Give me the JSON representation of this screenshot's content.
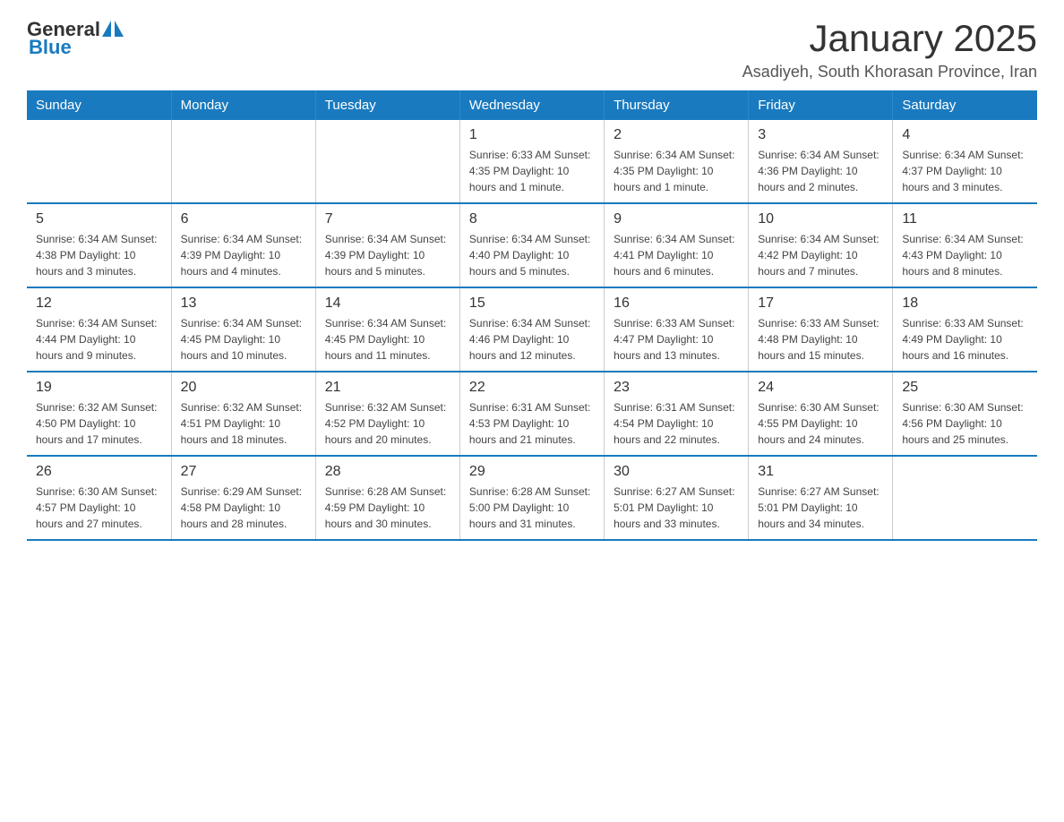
{
  "logo": {
    "general": "General",
    "blue": "Blue"
  },
  "title": "January 2025",
  "subtitle": "Asadiyeh, South Khorasan Province, Iran",
  "days_of_week": [
    "Sunday",
    "Monday",
    "Tuesday",
    "Wednesday",
    "Thursday",
    "Friday",
    "Saturday"
  ],
  "weeks": [
    [
      {
        "day": "",
        "info": ""
      },
      {
        "day": "",
        "info": ""
      },
      {
        "day": "",
        "info": ""
      },
      {
        "day": "1",
        "info": "Sunrise: 6:33 AM\nSunset: 4:35 PM\nDaylight: 10 hours and 1 minute."
      },
      {
        "day": "2",
        "info": "Sunrise: 6:34 AM\nSunset: 4:35 PM\nDaylight: 10 hours and 1 minute."
      },
      {
        "day": "3",
        "info": "Sunrise: 6:34 AM\nSunset: 4:36 PM\nDaylight: 10 hours and 2 minutes."
      },
      {
        "day": "4",
        "info": "Sunrise: 6:34 AM\nSunset: 4:37 PM\nDaylight: 10 hours and 3 minutes."
      }
    ],
    [
      {
        "day": "5",
        "info": "Sunrise: 6:34 AM\nSunset: 4:38 PM\nDaylight: 10 hours and 3 minutes."
      },
      {
        "day": "6",
        "info": "Sunrise: 6:34 AM\nSunset: 4:39 PM\nDaylight: 10 hours and 4 minutes."
      },
      {
        "day": "7",
        "info": "Sunrise: 6:34 AM\nSunset: 4:39 PM\nDaylight: 10 hours and 5 minutes."
      },
      {
        "day": "8",
        "info": "Sunrise: 6:34 AM\nSunset: 4:40 PM\nDaylight: 10 hours and 5 minutes."
      },
      {
        "day": "9",
        "info": "Sunrise: 6:34 AM\nSunset: 4:41 PM\nDaylight: 10 hours and 6 minutes."
      },
      {
        "day": "10",
        "info": "Sunrise: 6:34 AM\nSunset: 4:42 PM\nDaylight: 10 hours and 7 minutes."
      },
      {
        "day": "11",
        "info": "Sunrise: 6:34 AM\nSunset: 4:43 PM\nDaylight: 10 hours and 8 minutes."
      }
    ],
    [
      {
        "day": "12",
        "info": "Sunrise: 6:34 AM\nSunset: 4:44 PM\nDaylight: 10 hours and 9 minutes."
      },
      {
        "day": "13",
        "info": "Sunrise: 6:34 AM\nSunset: 4:45 PM\nDaylight: 10 hours and 10 minutes."
      },
      {
        "day": "14",
        "info": "Sunrise: 6:34 AM\nSunset: 4:45 PM\nDaylight: 10 hours and 11 minutes."
      },
      {
        "day": "15",
        "info": "Sunrise: 6:34 AM\nSunset: 4:46 PM\nDaylight: 10 hours and 12 minutes."
      },
      {
        "day": "16",
        "info": "Sunrise: 6:33 AM\nSunset: 4:47 PM\nDaylight: 10 hours and 13 minutes."
      },
      {
        "day": "17",
        "info": "Sunrise: 6:33 AM\nSunset: 4:48 PM\nDaylight: 10 hours and 15 minutes."
      },
      {
        "day": "18",
        "info": "Sunrise: 6:33 AM\nSunset: 4:49 PM\nDaylight: 10 hours and 16 minutes."
      }
    ],
    [
      {
        "day": "19",
        "info": "Sunrise: 6:32 AM\nSunset: 4:50 PM\nDaylight: 10 hours and 17 minutes."
      },
      {
        "day": "20",
        "info": "Sunrise: 6:32 AM\nSunset: 4:51 PM\nDaylight: 10 hours and 18 minutes."
      },
      {
        "day": "21",
        "info": "Sunrise: 6:32 AM\nSunset: 4:52 PM\nDaylight: 10 hours and 20 minutes."
      },
      {
        "day": "22",
        "info": "Sunrise: 6:31 AM\nSunset: 4:53 PM\nDaylight: 10 hours and 21 minutes."
      },
      {
        "day": "23",
        "info": "Sunrise: 6:31 AM\nSunset: 4:54 PM\nDaylight: 10 hours and 22 minutes."
      },
      {
        "day": "24",
        "info": "Sunrise: 6:30 AM\nSunset: 4:55 PM\nDaylight: 10 hours and 24 minutes."
      },
      {
        "day": "25",
        "info": "Sunrise: 6:30 AM\nSunset: 4:56 PM\nDaylight: 10 hours and 25 minutes."
      }
    ],
    [
      {
        "day": "26",
        "info": "Sunrise: 6:30 AM\nSunset: 4:57 PM\nDaylight: 10 hours and 27 minutes."
      },
      {
        "day": "27",
        "info": "Sunrise: 6:29 AM\nSunset: 4:58 PM\nDaylight: 10 hours and 28 minutes."
      },
      {
        "day": "28",
        "info": "Sunrise: 6:28 AM\nSunset: 4:59 PM\nDaylight: 10 hours and 30 minutes."
      },
      {
        "day": "29",
        "info": "Sunrise: 6:28 AM\nSunset: 5:00 PM\nDaylight: 10 hours and 31 minutes."
      },
      {
        "day": "30",
        "info": "Sunrise: 6:27 AM\nSunset: 5:01 PM\nDaylight: 10 hours and 33 minutes."
      },
      {
        "day": "31",
        "info": "Sunrise: 6:27 AM\nSunset: 5:01 PM\nDaylight: 10 hours and 34 minutes."
      },
      {
        "day": "",
        "info": ""
      }
    ]
  ]
}
